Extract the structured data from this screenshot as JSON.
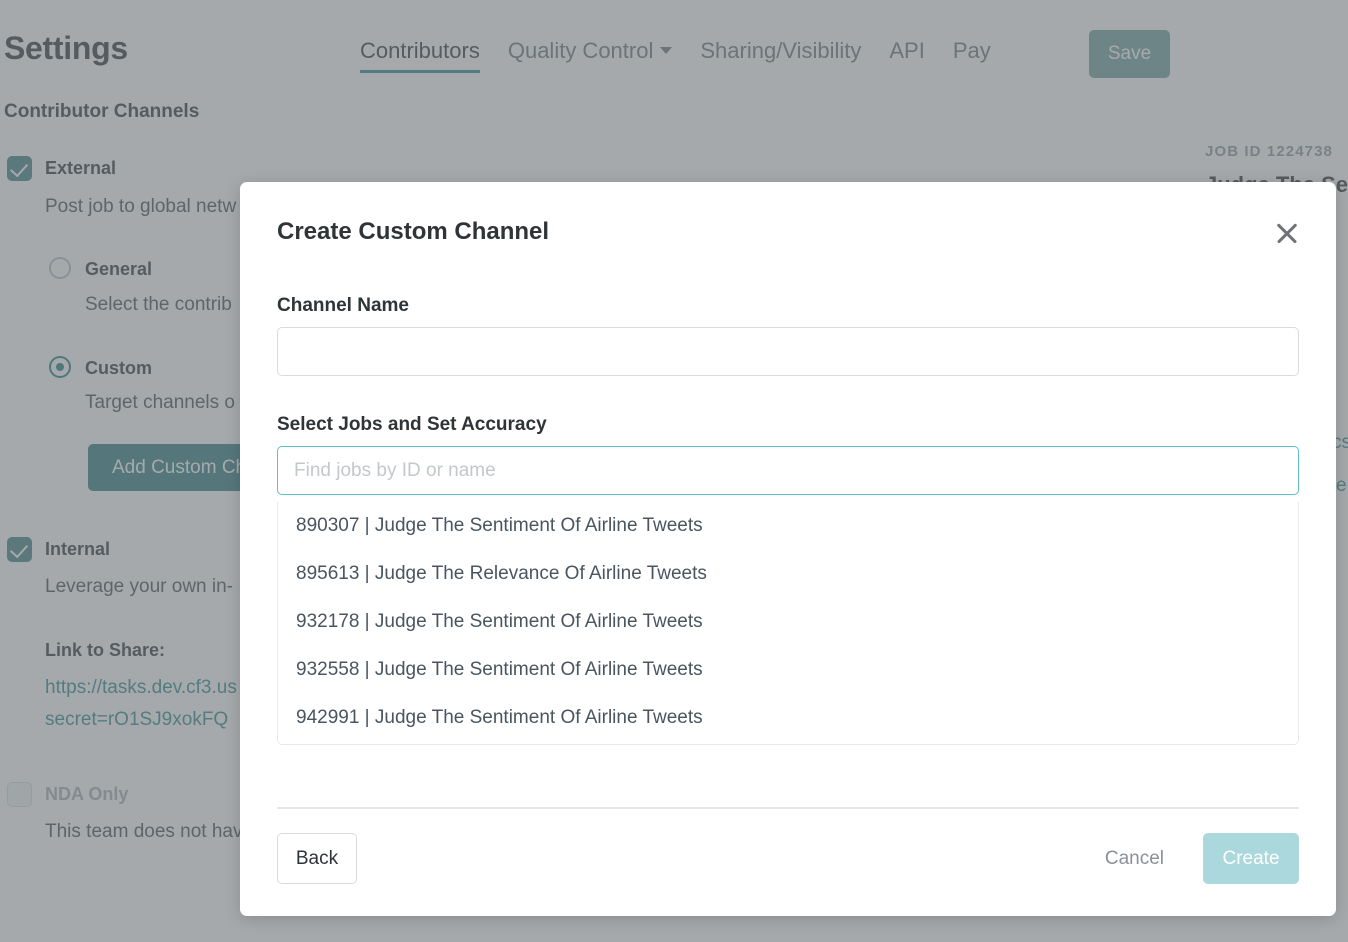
{
  "page": {
    "title": "Settings",
    "section_title": "Contributor Channels",
    "tabs": [
      {
        "label": "Contributors",
        "active": true
      },
      {
        "label": "Quality Control",
        "active": false,
        "has_caret": true
      },
      {
        "label": "Sharing/Visibility",
        "active": false
      },
      {
        "label": "API",
        "active": false
      },
      {
        "label": "Pay",
        "active": false
      }
    ],
    "save_label": "Save",
    "external": {
      "label": "External",
      "checked": true,
      "description": "Post job to global netw",
      "options": [
        {
          "label": "General",
          "selected": false,
          "description": "Select the contrib"
        },
        {
          "label": "Custom",
          "selected": true,
          "description": "Target channels o"
        }
      ],
      "add_channel_label": "Add Custom Ch"
    },
    "internal": {
      "label": "Internal",
      "checked": true,
      "description": "Leverage your own in-",
      "link_label": "Link to Share:",
      "link_line1": "https://tasks.dev.cf3.us",
      "link_line2": "secret=rO1SJ9xokFQ"
    },
    "nda": {
      "label": "NDA Only",
      "checked": false,
      "description": "This team does not hav"
    },
    "right_panel": {
      "job_id": "JOB ID 1224738",
      "job_name": "Judge The Senti",
      "fragment_1": "cs",
      "fragment_2": "e"
    }
  },
  "modal": {
    "title": "Create Custom Channel",
    "close_label": "close",
    "channel_name_label": "Channel Name",
    "channel_name_value": "",
    "channel_name_placeholder": "",
    "select_jobs_label": "Select Jobs and Set Accuracy",
    "job_search_value": "",
    "job_search_placeholder": "Find jobs by ID or name",
    "job_results": [
      "890307 | Judge The Sentiment Of Airline Tweets",
      "895613 | Judge The Relevance Of Airline Tweets",
      "932178 | Judge The Sentiment Of Airline Tweets",
      "932558 | Judge The Sentiment Of Airline Tweets",
      "942991 | Judge The Sentiment Of Airline Tweets"
    ],
    "back_label": "Back",
    "cancel_label": "Cancel",
    "create_label": "Create"
  },
  "colors": {
    "accent_teal": "#2a8a8f",
    "checkbox_teal": "#3d7f85",
    "button_teal": "#2f7d84",
    "create_teal": "#abd8dd",
    "text_dark": "#2f3437",
    "text_muted": "#6b7377"
  }
}
